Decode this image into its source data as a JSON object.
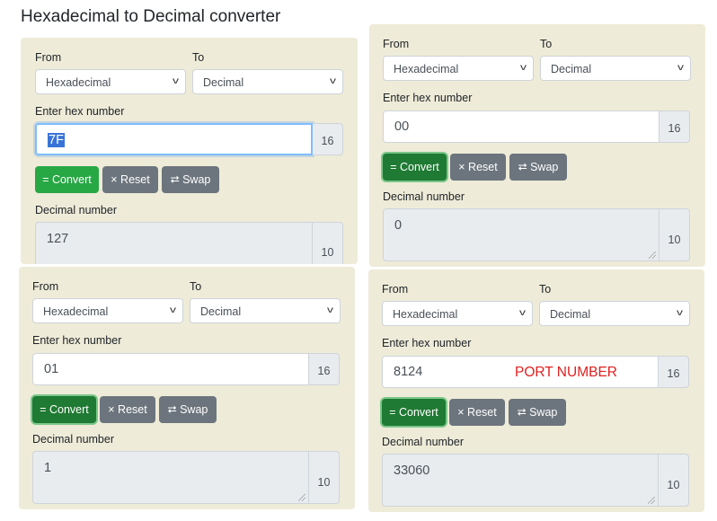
{
  "page": {
    "title": "Hexadecimal to Decimal converter"
  },
  "labels": {
    "from": "From",
    "to": "To",
    "enter_hex": "Enter hex number",
    "decimal_number": "Decimal number",
    "from_base": "16",
    "to_base": "10"
  },
  "selects": {
    "from_value": "Hexadecimal",
    "to_value": "Decimal"
  },
  "buttons": {
    "convert": "= Convert",
    "reset": "× Reset",
    "swap": "⮂ Swap"
  },
  "converters": [
    {
      "hex_value": "7F",
      "decimal_value": "127"
    },
    {
      "hex_value": "00",
      "decimal_value": "0"
    },
    {
      "hex_value": "01",
      "decimal_value": "1"
    },
    {
      "hex_value": "8124",
      "decimal_value": "33060"
    }
  ],
  "annotation": "PORT NUMBER",
  "colors": {
    "panel_bg": "#eeebd8",
    "convert_green": "#28a745",
    "gray_button": "#6c757d",
    "annotation_red": "#e02020",
    "selection_blue": "#3874d8"
  }
}
